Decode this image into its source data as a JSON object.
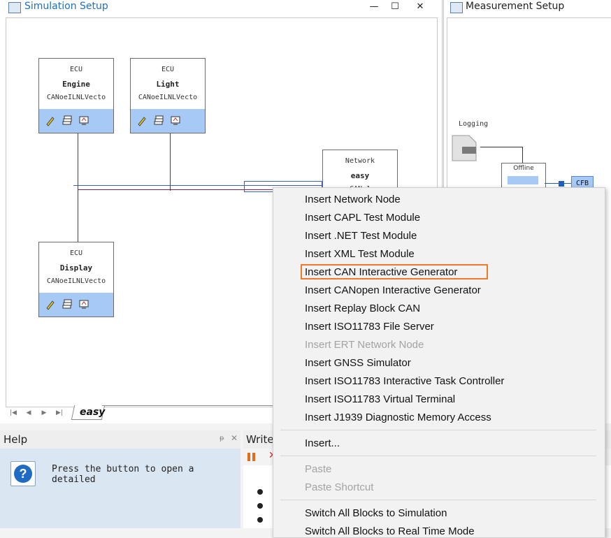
{
  "simulation_window": {
    "title": "Simulation Setup",
    "controls": {
      "minimize": "—",
      "maximize": "☐",
      "close": "✕"
    },
    "nodes": [
      {
        "type": "ECU",
        "name": "Engine",
        "database": "CANoeILNLVecto"
      },
      {
        "type": "ECU",
        "name": "Light",
        "database": "CANoeILNLVecto"
      },
      {
        "type": "ECU",
        "name": "Display",
        "database": "CANoeILNLVecto"
      }
    ],
    "network": {
      "type": "Network",
      "name": "easy",
      "partial": "CAN 1"
    },
    "bottom_tab": {
      "label": "easy"
    }
  },
  "measurement_window": {
    "title": "Measurement Setup",
    "logging_label": "Logging",
    "offline_label": "Offline",
    "cfb_label": "CFB"
  },
  "help_pane": {
    "title": "Help",
    "pin": "ᵽ",
    "close": "✕",
    "text": "Press the button to open a detailed"
  },
  "write_pane": {
    "title": "Write",
    "stop": "✕"
  },
  "context_menu": {
    "items": [
      {
        "label": "Insert Network Node",
        "enabled": true
      },
      {
        "label": "Insert CAPL Test Module",
        "enabled": true
      },
      {
        "label": "Insert .NET Test Module",
        "enabled": true
      },
      {
        "label": "Insert XML Test Module",
        "enabled": true
      },
      {
        "label": "Insert CAN Interactive Generator",
        "enabled": true,
        "highlighted": true
      },
      {
        "label": "Insert CANopen Interactive Generator",
        "enabled": true
      },
      {
        "label": "Insert Replay Block CAN",
        "enabled": true
      },
      {
        "label": "Insert ISO11783 File Server",
        "enabled": true
      },
      {
        "label": "Insert ERT Network Node",
        "enabled": false
      },
      {
        "label": "Insert GNSS Simulator",
        "enabled": true
      },
      {
        "label": "Insert ISO11783 Interactive Task Controller",
        "enabled": true
      },
      {
        "label": "Insert ISO11783 Virtual Terminal",
        "enabled": true
      },
      {
        "label": "Insert J1939 Diagnostic Memory Access",
        "enabled": true
      }
    ],
    "insert_more": "Insert...",
    "paste": "Paste",
    "paste_shortcut": "Paste Shortcut",
    "switch_sim": "Switch All Blocks to Simulation",
    "switch_real": "Switch All Blocks to Real Time Mode"
  },
  "colors": {
    "accent_blue": "#1f6fbf",
    "node_bar": "#a7c9f5",
    "wire": "#7a1f5c",
    "highlight": "#f07a2a"
  }
}
